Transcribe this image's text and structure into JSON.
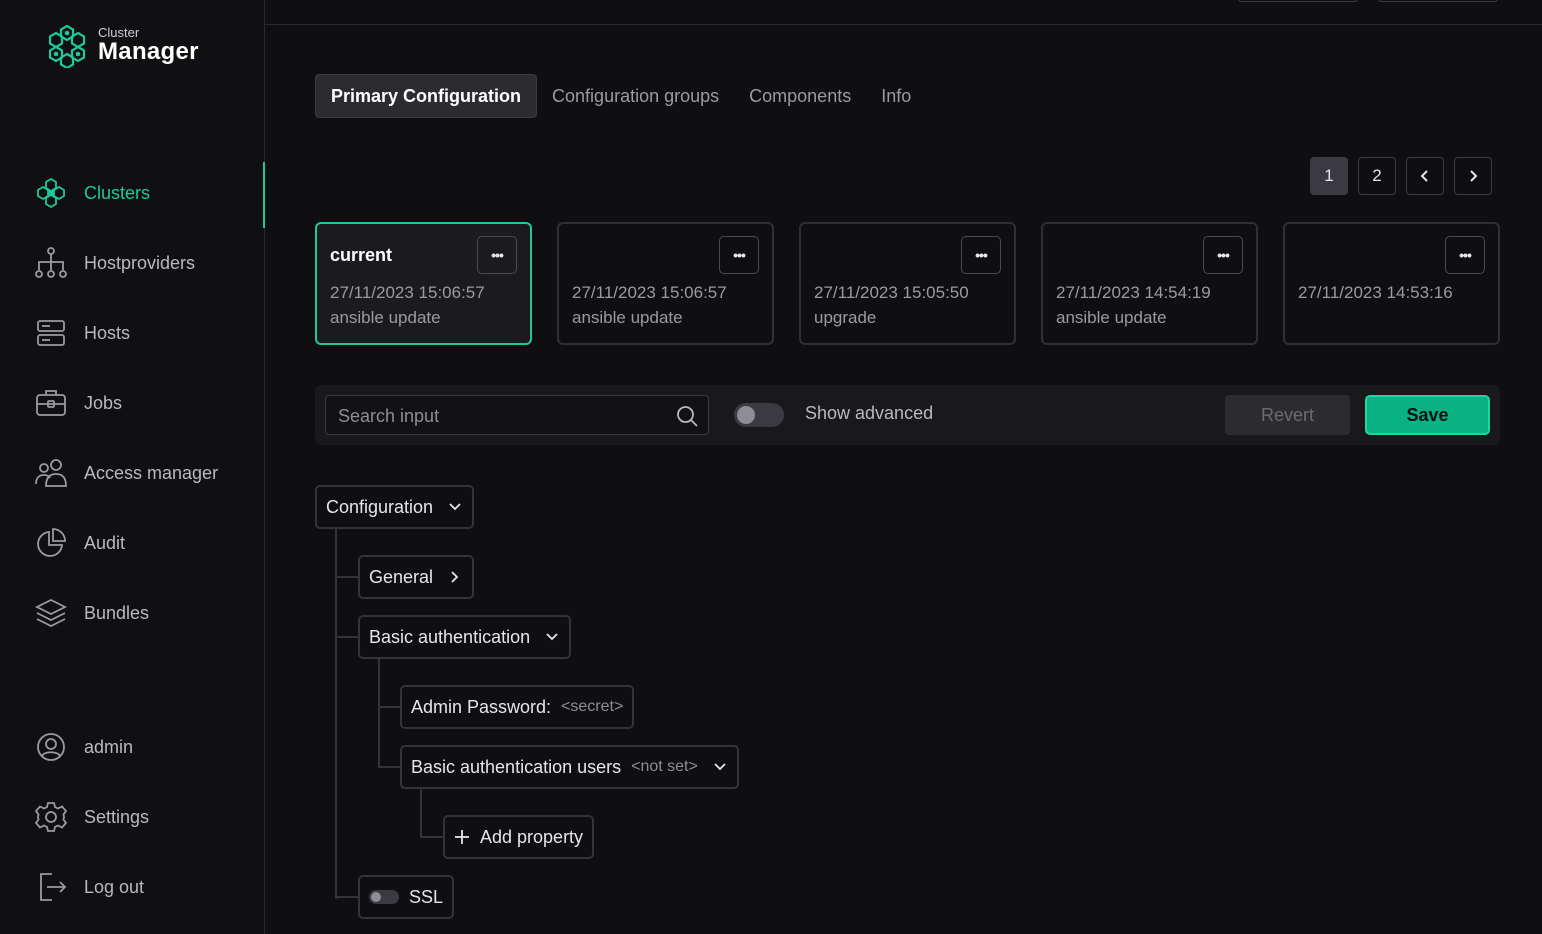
{
  "app": {
    "brand_small": "Cluster",
    "brand_big": "Manager",
    "accent": "#1fc89a"
  },
  "sidebar": {
    "items": [
      {
        "label": "Clusters",
        "icon": "clusters-icon",
        "active": true
      },
      {
        "label": "Hostproviders",
        "icon": "hierarchy-icon"
      },
      {
        "label": "Hosts",
        "icon": "server-icon"
      },
      {
        "label": "Jobs",
        "icon": "briefcase-icon"
      },
      {
        "label": "Access manager",
        "icon": "users-icon"
      },
      {
        "label": "Audit",
        "icon": "pie-chart-icon"
      },
      {
        "label": "Bundles",
        "icon": "layers-icon"
      }
    ],
    "bottom": [
      {
        "label": "admin",
        "icon": "user-circle-icon"
      },
      {
        "label": "Settings",
        "icon": "gear-icon"
      },
      {
        "label": "Log out",
        "icon": "logout-icon"
      }
    ]
  },
  "tabs": [
    "Primary Configuration",
    "Configuration groups",
    "Components",
    "Info"
  ],
  "pagination": {
    "pages": [
      "1",
      "2"
    ],
    "current": "1"
  },
  "versions": [
    {
      "title": "current",
      "date": "27/11/2023 15:06:57",
      "description": "ansible update",
      "active": true
    },
    {
      "title": "",
      "date": "27/11/2023 15:06:57",
      "description": "ansible update"
    },
    {
      "title": "",
      "date": "27/11/2023 15:05:50",
      "description": "upgrade"
    },
    {
      "title": "",
      "date": "27/11/2023 14:54:19",
      "description": "ansible update"
    },
    {
      "title": "",
      "date": "27/11/2023 14:53:16",
      "description": ""
    }
  ],
  "toolbar": {
    "search_placeholder": "Search input",
    "show_advanced_label": "Show advanced",
    "show_advanced_on": false,
    "revert_label": "Revert",
    "save_label": "Save"
  },
  "tree": {
    "root": "Configuration",
    "general": "General",
    "basic_auth": "Basic authentication",
    "admin_password_label": "Admin Password:",
    "admin_password_value": "<secret>",
    "basic_auth_users_label": "Basic authentication users",
    "basic_auth_users_value": "<not set>",
    "add_property_label": "Add property",
    "ssl_label": "SSL",
    "ssl_on": false
  }
}
